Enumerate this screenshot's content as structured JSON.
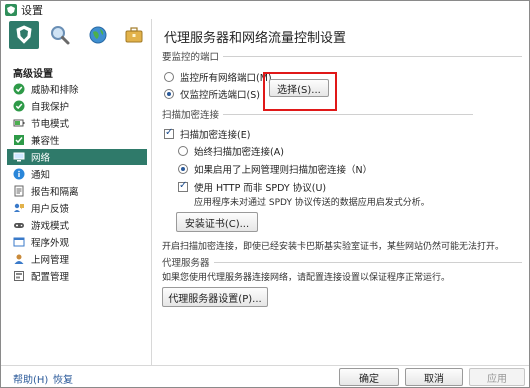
{
  "window": {
    "title": "设置"
  },
  "toolbar": {
    "icons": [
      "shield-icon",
      "search-icon",
      "globe-icon",
      "briefcase-icon"
    ]
  },
  "sidebar": {
    "group_title": "高级设置",
    "items": [
      {
        "label": "威胁和排除",
        "icon": "check-circle-icon"
      },
      {
        "label": "自我保护",
        "icon": "check-circle-icon"
      },
      {
        "label": "节电模式",
        "icon": "battery-icon"
      },
      {
        "label": "兼容性",
        "icon": "checkbox-icon"
      },
      {
        "label": "网络",
        "icon": "network-icon",
        "active": true
      },
      {
        "label": "通知",
        "icon": "info-icon"
      },
      {
        "label": "报告和隔离",
        "icon": "report-icon"
      },
      {
        "label": "用户反馈",
        "icon": "feedback-icon"
      },
      {
        "label": "游戏模式",
        "icon": "gamepad-icon"
      },
      {
        "label": "程序外观",
        "icon": "appearance-icon"
      },
      {
        "label": "上网管理",
        "icon": "user-icon"
      },
      {
        "label": "配置管理",
        "icon": "config-icon"
      }
    ]
  },
  "main": {
    "title": "代理服务器和网络流量控制设置",
    "ports_section": "要监控的端口",
    "radio_all_ports": "监控所有网络端口(M)",
    "radio_selected_ports": "仅监控所选端口(S)",
    "select_button": "选择(S)...",
    "scan_section": "扫描加密连接",
    "check_scan_encrypted": "扫描加密连接(E)",
    "radio_always_scan": "始终扫描加密连接(A)",
    "radio_scan_if_enabled": "如果启用了上网管理则扫描加密连接（N）",
    "check_spdy": "使用 HTTP 而非 SPDY 协议(U)",
    "spdy_note": "应用程序未对通过 SPDY 协议传送的数据应用启发式分析。",
    "install_cert_button": "安装证书(C)...",
    "cert_note": "开启扫描加密连接，即使已经安装卡巴斯基实验室证书，某些网站仍然可能无法打开。",
    "proxy_section": "代理服务器",
    "proxy_note": "如果您使用代理服务器连接网络，请配置连接设置以保证程序正常运行。",
    "proxy_button": "代理服务器设置(P)..."
  },
  "footer": {
    "help": "帮助(H)",
    "restore": "恢复",
    "ok": "确定",
    "cancel": "取消",
    "apply": "应用"
  },
  "colors": {
    "accent": "#2f7a6a",
    "highlight": "#e01818",
    "link": "#2b5a9a"
  }
}
